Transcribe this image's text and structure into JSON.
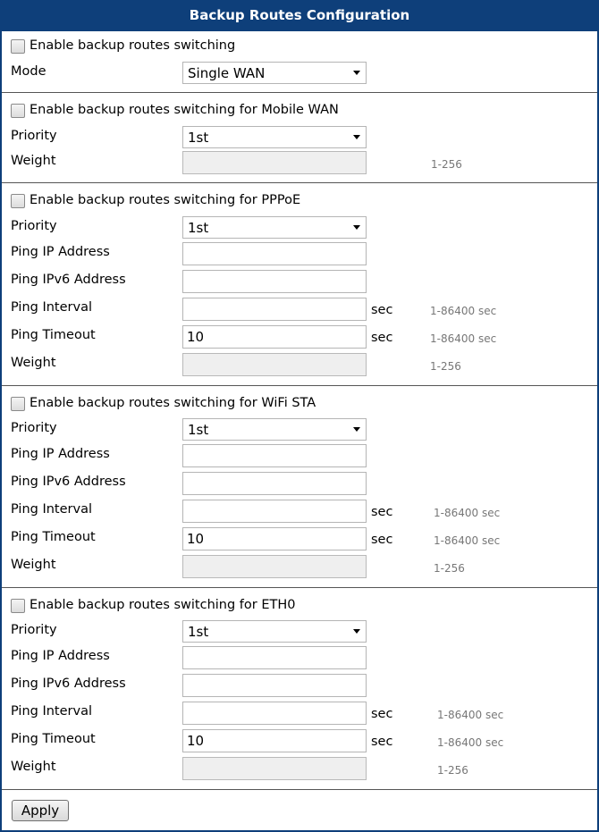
{
  "title": "Backup Routes Configuration",
  "general": {
    "enable_label": "Enable backup routes switching",
    "mode_label": "Mode",
    "mode_value": "Single WAN"
  },
  "mobile_wan": {
    "enable_label": "Enable backup routes switching for Mobile WAN",
    "priority_label": "Priority",
    "priority_value": "1st",
    "weight_label": "Weight",
    "weight_hint": "1-256"
  },
  "pppoe": {
    "enable_label": "Enable backup routes switching for PPPoE",
    "priority_label": "Priority",
    "priority_value": "1st",
    "ping_ip_label": "Ping IP Address",
    "ping_ipv6_label": "Ping IPv6 Address",
    "ping_interval_label": "Ping Interval",
    "ping_interval_unit": "sec",
    "ping_interval_hint": "1-86400 sec",
    "ping_timeout_label": "Ping Timeout",
    "ping_timeout_value": "10",
    "ping_timeout_unit": "sec",
    "ping_timeout_hint": "1-86400 sec",
    "weight_label": "Weight",
    "weight_hint": "1-256"
  },
  "wifi_sta": {
    "enable_label": "Enable backup routes switching for WiFi STA",
    "priority_label": "Priority",
    "priority_value": "1st",
    "ping_ip_label": "Ping IP Address",
    "ping_ipv6_label": "Ping IPv6 Address",
    "ping_interval_label": "Ping Interval",
    "ping_interval_unit": "sec",
    "ping_interval_hint": "1-86400 sec",
    "ping_timeout_label": "Ping Timeout",
    "ping_timeout_value": "10",
    "ping_timeout_unit": "sec",
    "ping_timeout_hint": "1-86400 sec",
    "weight_label": "Weight",
    "weight_hint": "1-256"
  },
  "eth0": {
    "enable_label": "Enable backup routes switching for ETH0",
    "priority_label": "Priority",
    "priority_value": "1st",
    "ping_ip_label": "Ping IP Address",
    "ping_ipv6_label": "Ping IPv6 Address",
    "ping_interval_label": "Ping Interval",
    "ping_interval_unit": "sec",
    "ping_interval_hint": "1-86400 sec",
    "ping_timeout_label": "Ping Timeout",
    "ping_timeout_value": "10",
    "ping_timeout_unit": "sec",
    "ping_timeout_hint": "1-86400 sec",
    "weight_label": "Weight",
    "weight_hint": "1-256"
  },
  "apply_label": "Apply",
  "colors": {
    "title_bar": "#0e3f7a",
    "disabled_field": "#efefef",
    "hint_text": "#777777"
  }
}
